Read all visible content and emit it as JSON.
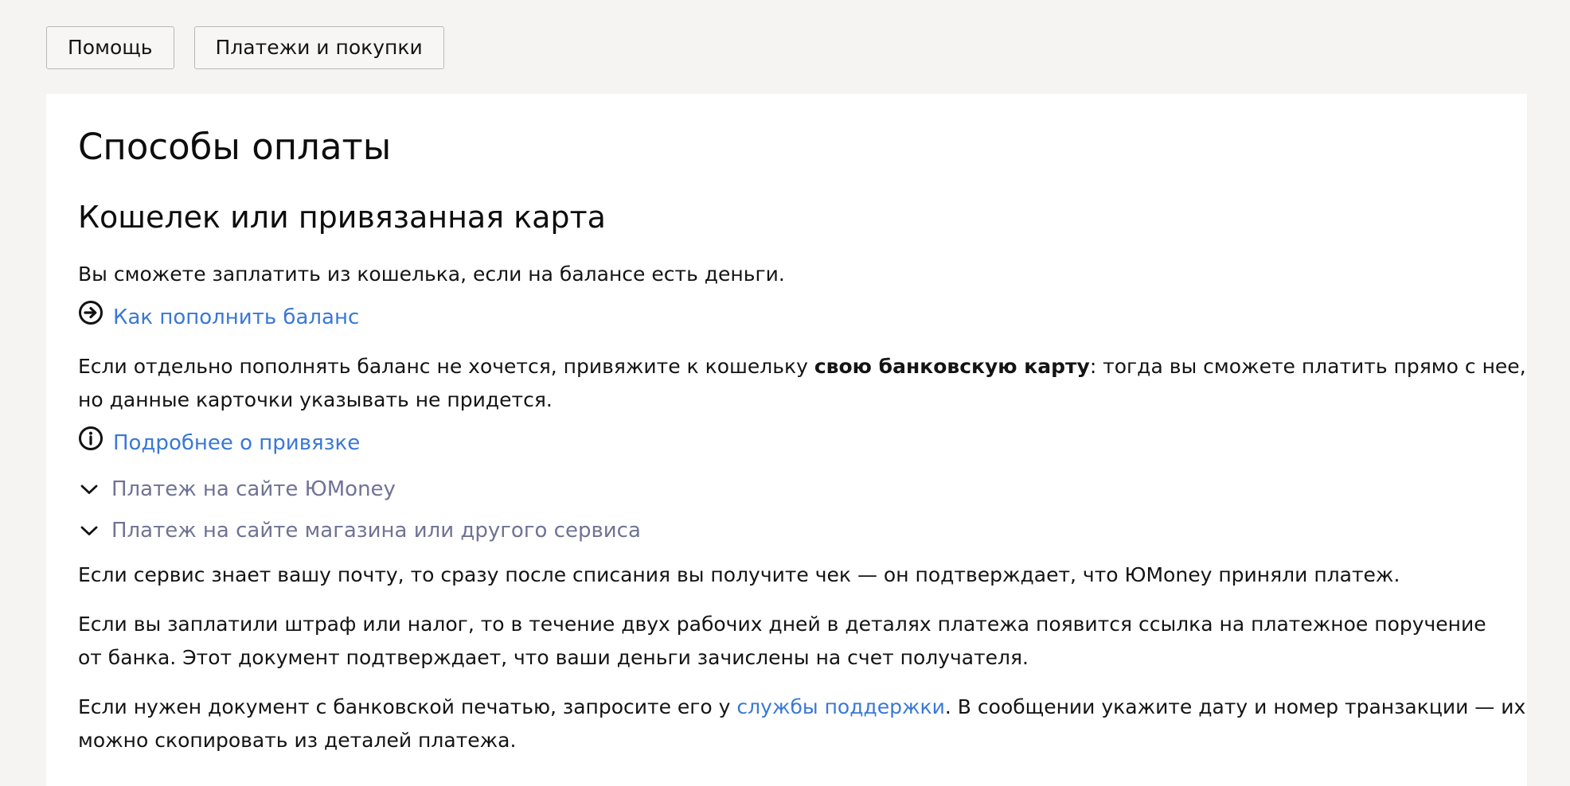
{
  "breadcrumbs": [
    {
      "label": "Помощь"
    },
    {
      "label": "Платежи и покупки"
    }
  ],
  "article": {
    "title": "Способы оплаты",
    "section_title": "Кошелек или привязанная карта",
    "p1": "Вы сможете заплатить из кошелька, если на балансе есть деньги.",
    "link_topup": "Как пополнить баланс",
    "p2_part1": "Если отдельно пополнять баланс не хочется, привяжите к кошельку ",
    "p2_bold": "свою банковскую карту",
    "p2_part2": ": тогда вы сможете платить прямо с нее,",
    "p2_line2": "но данные карточки указывать не придется.",
    "link_binding": "Подробнее о привязке",
    "accordions": [
      {
        "label": "Платеж на сайте ЮMoney"
      },
      {
        "label": "Платеж на сайте магазина или другого сервиса"
      }
    ],
    "p3": "Если сервис знает вашу почту, то сразу после списания вы получите чек — он подтверждает, что ЮMoney приняли платеж.",
    "p4_line1": "Если вы заплатили штраф или налог, то в течение двух рабочих дней в деталях платежа появится ссылка на платежное поручение",
    "p4_line2": "от банка. Этот документ подтверждает, что ваши деньги зачислены на счет получателя.",
    "p5_part1": "Если нужен документ с банковской печатью, запросите его у ",
    "p5_link": "службы поддержки",
    "p5_part2": ". В сообщении укажите дату и номер транзакции — их",
    "p5_line2": "можно скопировать из деталей платежа."
  },
  "icons": {
    "topup": "arrow-circle-right-icon",
    "binding": "info-circle-icon",
    "accordion": "chevron-down-icon"
  },
  "colors": {
    "link": "#3a78d6",
    "accordion_text": "#6f7394",
    "page_bg": "#f5f4f2",
    "card_bg": "#ffffff"
  }
}
